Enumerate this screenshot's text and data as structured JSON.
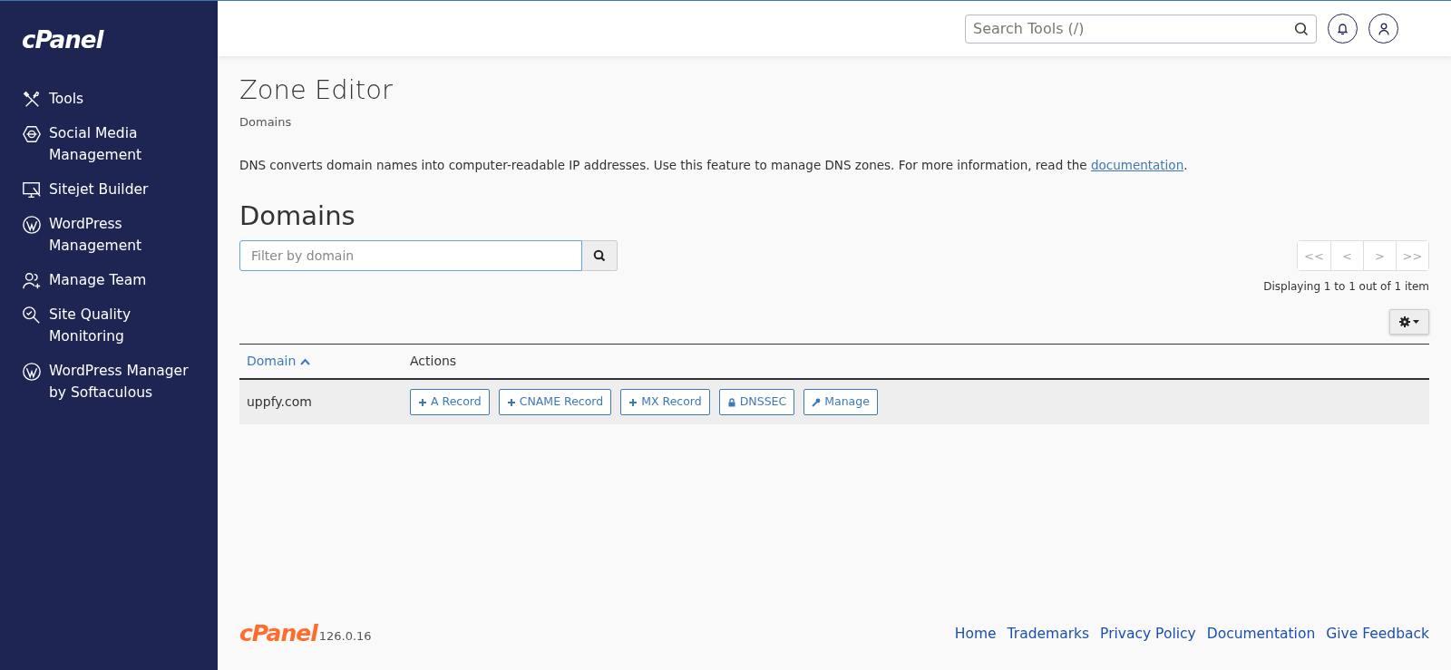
{
  "sidebar": {
    "logo": "cPanel",
    "items": [
      {
        "label": "Tools",
        "kind": "tools"
      },
      {
        "label": "Social Media Management",
        "kind": "social"
      },
      {
        "label": "Sitejet Builder",
        "kind": "builder"
      },
      {
        "label": "WordPress Management",
        "kind": "wordpress"
      },
      {
        "label": "Manage Team",
        "kind": "team"
      },
      {
        "label": "Site Quality Monitoring",
        "kind": "quality"
      },
      {
        "label": "WordPress Manager by Softaculous",
        "kind": "wordpress"
      }
    ]
  },
  "header": {
    "search": {
      "placeholder": "Search Tools (/)"
    }
  },
  "page": {
    "title": "Zone Editor",
    "breadcrumb": "Domains",
    "description": "DNS converts domain names into computer-readable IP addresses. Use this feature to manage DNS zones. For more information, read the ",
    "description_link": "documentation",
    "description_end": "."
  },
  "domains": {
    "heading": "Domains",
    "filter": {
      "placeholder": "Filter by domain"
    },
    "pagination": [
      {
        "label": "<<",
        "disabled": true
      },
      {
        "label": "<",
        "disabled": true
      },
      {
        "label": ">",
        "disabled": true
      },
      {
        "label": ">>",
        "disabled": true
      }
    ],
    "displaying": "Displaying 1 to 1 out of 1 item",
    "table": {
      "columns": [
        {
          "label": "Domain",
          "sortable": true
        },
        {
          "label": "Actions",
          "sortable": false
        }
      ],
      "rows": [
        {
          "domain": "uppfy.com",
          "actions": [
            {
              "label": "A Record",
              "kind": "add"
            },
            {
              "label": "CNAME Record",
              "kind": "add"
            },
            {
              "label": "MX Record",
              "kind": "add"
            },
            {
              "label": "DNSSEC",
              "kind": "security"
            },
            {
              "label": "Manage",
              "kind": "manage"
            }
          ]
        }
      ]
    }
  },
  "footer": {
    "logo": "cPanel",
    "version": "126.0.16",
    "links": [
      "Home",
      "Trademarks",
      "Privacy Policy",
      "Documentation",
      "Give Feedback"
    ]
  }
}
